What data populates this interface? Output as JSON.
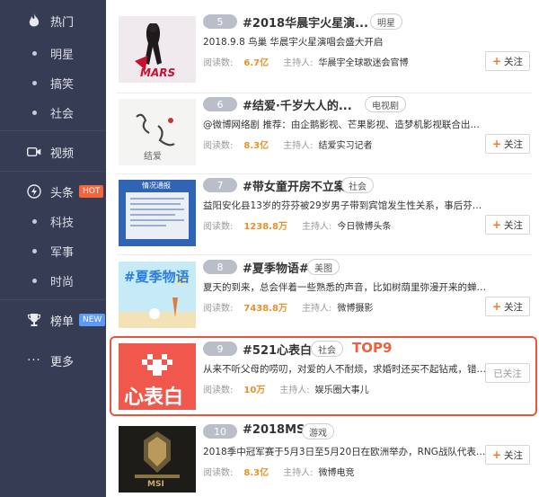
{
  "sidebar": {
    "items": [
      {
        "label": "热门",
        "icon": "flame-icon",
        "type": "main"
      },
      {
        "label": "明星",
        "type": "sub"
      },
      {
        "label": "搞笑",
        "type": "sub"
      },
      {
        "label": "社会",
        "type": "sub"
      },
      {
        "label": "视频",
        "icon": "video-icon",
        "type": "main"
      },
      {
        "label": "头条",
        "icon": "lightning-icon",
        "type": "main",
        "badge": "HOT"
      },
      {
        "label": "科技",
        "type": "sub"
      },
      {
        "label": "军事",
        "type": "sub"
      },
      {
        "label": "时尚",
        "type": "sub"
      },
      {
        "label": "榜单",
        "icon": "trophy-icon",
        "type": "main",
        "badge": "NEW"
      },
      {
        "label": "更多",
        "icon": "more-dots-icon",
        "type": "main"
      }
    ],
    "colors": {
      "background": "#373c55",
      "hot_badge": "#f5653b",
      "new_badge": "#5b9bf5"
    }
  },
  "labels": {
    "reads": "阅读数:",
    "host": "主持人:",
    "follow": "关注",
    "followed": "已关注"
  },
  "topics": [
    {
      "rank": "5",
      "title": "#2018华晨宇火星演...",
      "tag": "明星",
      "desc": "2018.9.8 鸟巢 华晨宇火星演唱会盛大开启",
      "reads": "6.7亿",
      "host": "华晨宇全球歌迷会官博",
      "followed": false,
      "thumb_text": "MARS"
    },
    {
      "rank": "6",
      "title": "#结爱·千岁大人的...",
      "tag": "电视剧",
      "desc": "@微博网络剧 推荐：由企鹅影视、芒果影视、造梦机影视联合出品的奇幻...",
      "reads": "8.3亿",
      "host": "结爱实习记者",
      "followed": false,
      "thumb_text": "结爱"
    },
    {
      "rank": "7",
      "title": "#带女童开房不立案#",
      "tag": "社会",
      "desc": "益阳安化县13岁的芬芬被29岁男子带到宾馆发生性关系，事后芬芬家人报...",
      "reads": "1238.8万",
      "host": "今日微博头条",
      "followed": false,
      "thumb_text": "情况通报"
    },
    {
      "rank": "8",
      "title": "#夏季物语#",
      "tag": "美图",
      "desc": "夏天的到来，总会伴着一些熟悉的声音，比如树荫里弥漫开来的蝉鸣声...盛...",
      "reads": "7438.8万",
      "host": "微博摄影",
      "followed": false,
      "thumb_text": "#夏季物语"
    },
    {
      "rank": "9",
      "title": "#521心表白#",
      "tag": "社会",
      "desc": "从来不听父母的唠叨，对爱的人不耐烦，求婚时还买不起钻戒，错过兄弟...",
      "reads": "10万",
      "host": "娱乐圈大事儿",
      "followed": true,
      "thumb_text": "心表白",
      "highlight": "TOP9"
    },
    {
      "rank": "10",
      "title": "#2018MSI#",
      "tag": "游戏",
      "desc": "2018季中冠军赛于5月3日至5月20日在欧洲举办，RNG战队代表LPL赛区出征...",
      "reads": "8.3亿",
      "host": "微博电竞",
      "followed": false,
      "thumb_text": "MSI"
    }
  ],
  "colors": {
    "accent_orange": "#e8912b",
    "highlight_red": "#e8573b",
    "rank_badge": "#b9bec9"
  }
}
